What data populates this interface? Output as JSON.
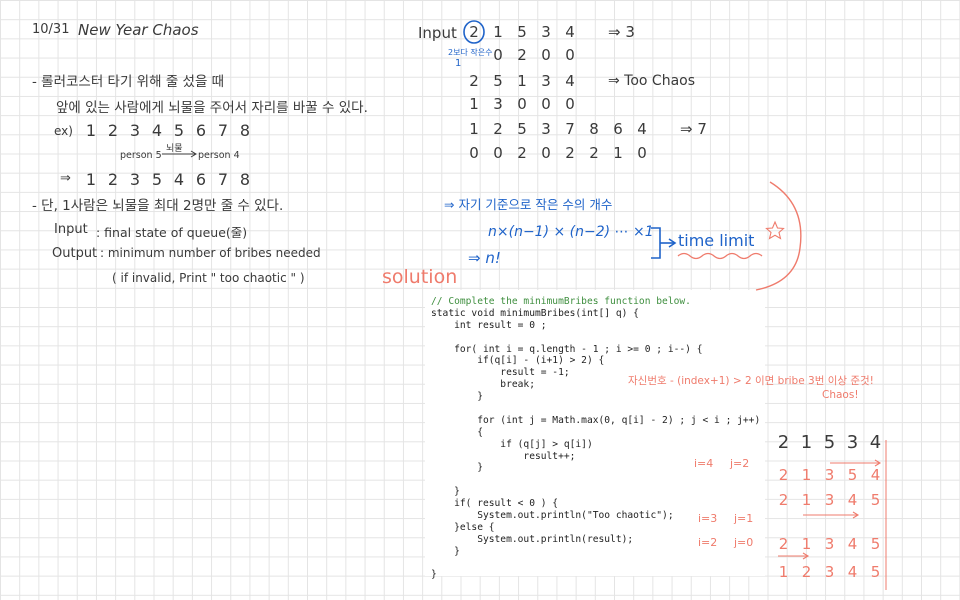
{
  "header": {
    "date": "10/31",
    "title": "New Year Chaos"
  },
  "notes": {
    "bullet1_line1": "- 롤러코스터 타기 위해 줄 섰을 때",
    "bullet1_line2": "앞에 있는 사람에게 뇌물을 주어서 자리를 바꿀 수 있다.",
    "example_label": "ex)",
    "example_row1": [
      "1",
      "2",
      "3",
      "4",
      "5",
      "6",
      "7",
      "8"
    ],
    "swap_left": "person 5",
    "swap_mid": "뇌물",
    "swap_right": "person 4",
    "arrow": "⇒",
    "example_row2": [
      "1",
      "2",
      "3",
      "5",
      "4",
      "6",
      "7",
      "8"
    ],
    "bullet2": "- 단, 1사람은 뇌물을 최대 2명만 줄 수 있다.",
    "input_label": "Input",
    "input_text": ": final state of queue(줄)",
    "output_label": "Output",
    "output_text": ": minimum number of bribes needed",
    "output_note": "( if invalid, Print \" too chaotic \" )"
  },
  "examples": {
    "input_label": "Input",
    "ex1_seq": [
      "2",
      "1",
      "5",
      "3",
      "4"
    ],
    "ex1_result": "⇒ 3",
    "ex1_note": "2보다 작은수",
    "ex1_count_prefix": "1",
    "ex1_counts": [
      "0",
      "2",
      "0",
      "0"
    ],
    "ex2_seq": [
      "2",
      "5",
      "1",
      "3",
      "4"
    ],
    "ex2_result": "⇒ Too Chaos",
    "ex2_counts": [
      "1",
      "3",
      "0",
      "0",
      "0"
    ],
    "ex3_seq": [
      "1",
      "2",
      "5",
      "3",
      "7",
      "8",
      "6",
      "4"
    ],
    "ex3_result": "⇒ 7",
    "ex3_counts": [
      "0",
      "0",
      "2",
      "0",
      "2",
      "2",
      "1",
      "0"
    ],
    "complexity_note": "⇒ 자기 기준으로 작은 수의 개수",
    "complexity_formula": "n×(n−1) × (n−2) ⋯ ×1",
    "complexity_result": "⇒ n!",
    "time_limit": "time limit"
  },
  "solution_label": "solution",
  "code": {
    "comment": "// Complete the minimumBribes function below.",
    "lines": [
      "static void minimumBribes(int[] q) {",
      "    int result = 0 ;",
      "",
      "    for( int i = q.length - 1 ; i >= 0 ; i--) {",
      "        if(q[i] - (i+1) > 2) {",
      "            result = -1;",
      "            break;",
      "        }",
      "",
      "        for (int j = Math.max(0, q[i] - 2) ; j < i ; j++)",
      "        {",
      "            if (q[j] > q[i])",
      "                result++;",
      "        }",
      "",
      "    }",
      "    if( result < 0 ) {",
      "        System.out.println(\"Too chaotic\");",
      "    }else {",
      "        System.out.println(result);",
      "    }",
      "",
      "}"
    ]
  },
  "annotations": {
    "chaos_note_line1": "자신번호 - (index+1) > 2 이면 bribe 3번 이상 준것!",
    "chaos_note_line2": "Chaos!",
    "i4": "i=4",
    "j2": "j=2",
    "i3": "i=3",
    "j1": "j=1",
    "i2": "i=2",
    "j0": "j=0"
  },
  "trace": {
    "top": [
      "2",
      "1",
      "5",
      "3",
      "4"
    ],
    "row1": [
      "2",
      "1",
      "3",
      "5",
      "4"
    ],
    "row2": [
      "2",
      "1",
      "3",
      "4",
      "5"
    ],
    "row3": [
      "2",
      "1",
      "3",
      "4",
      "5"
    ],
    "row4": [
      "1",
      "2",
      "3",
      "4",
      "5"
    ]
  },
  "colors": {
    "blue": "#1f63c9",
    "red": "#ef7b6c",
    "ink": "#3a3a3a"
  }
}
